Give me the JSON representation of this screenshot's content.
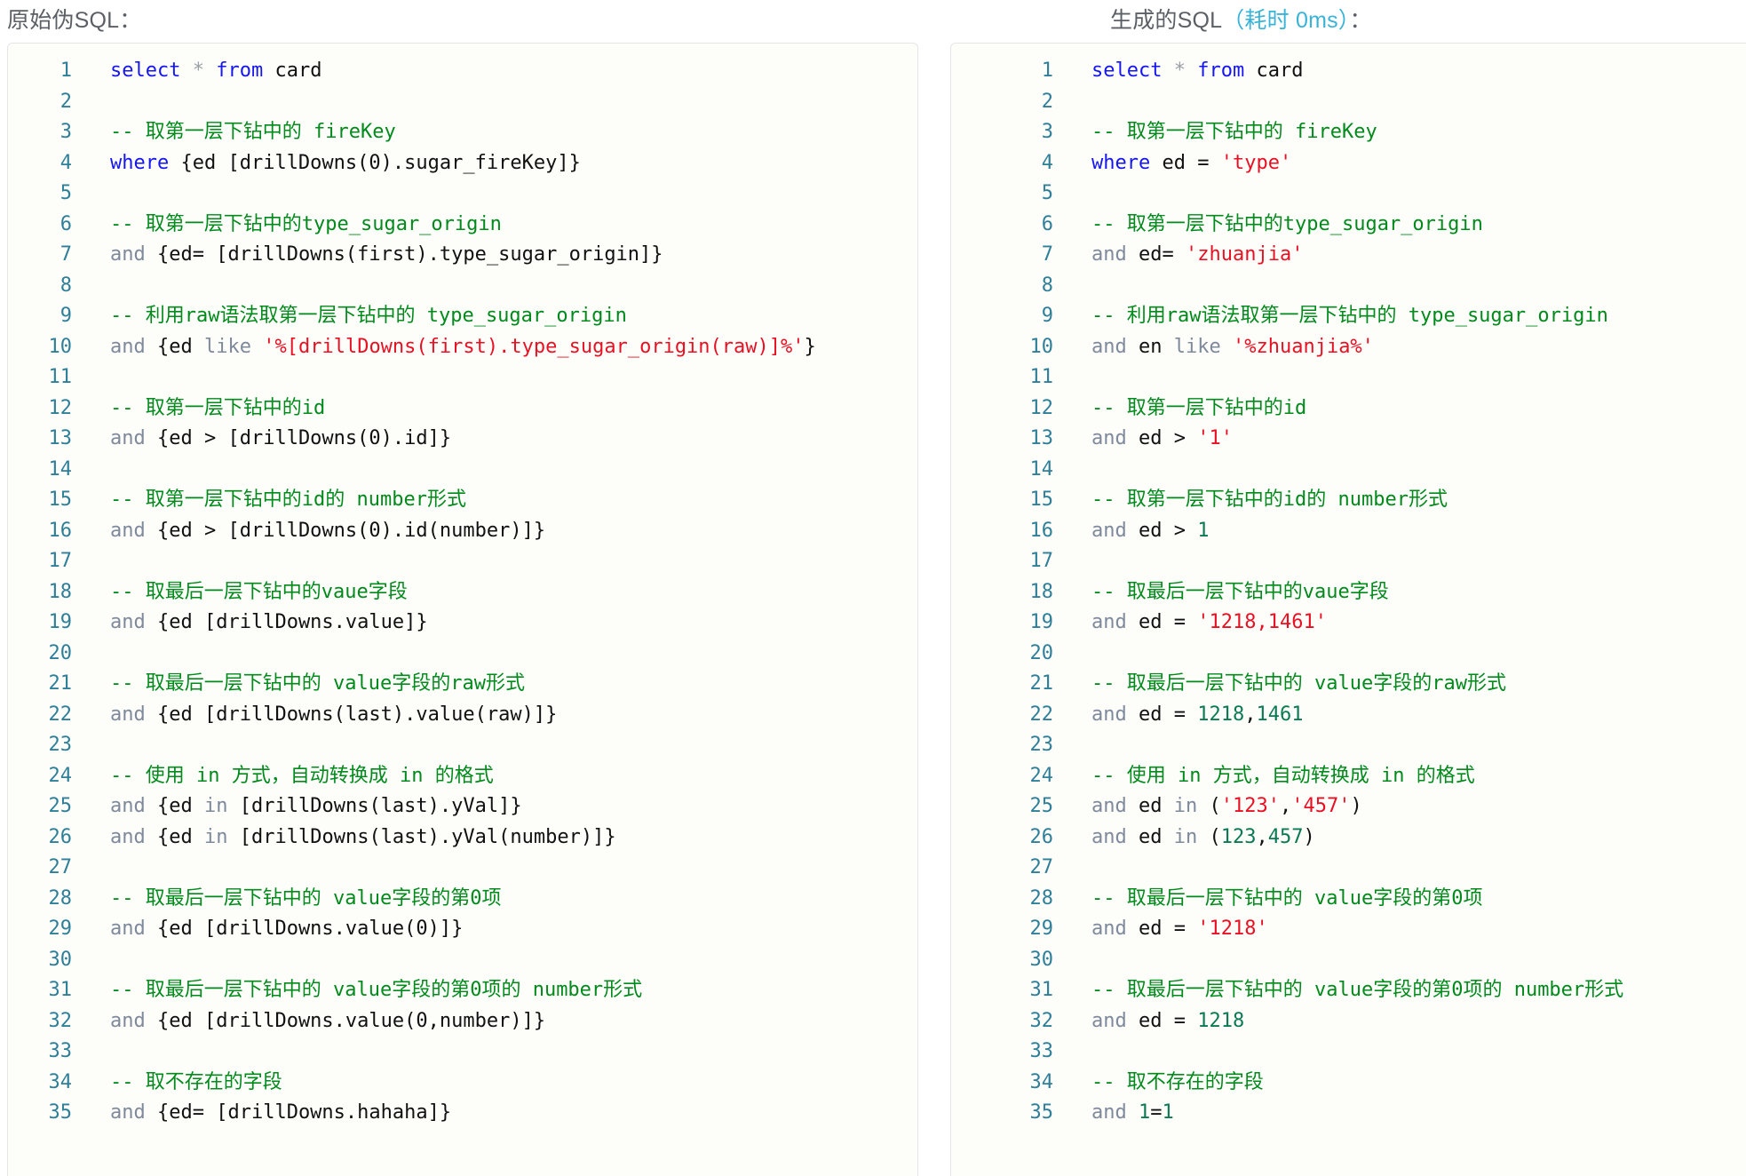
{
  "left": {
    "title": "原始伪SQL：",
    "lines": [
      {
        "n": "1",
        "tokens": [
          {
            "t": "kw",
            "v": "select"
          },
          {
            "t": "plain",
            "v": " "
          },
          {
            "t": "star",
            "v": "*"
          },
          {
            "t": "plain",
            "v": " "
          },
          {
            "t": "kw",
            "v": "from"
          },
          {
            "t": "plain",
            "v": " "
          },
          {
            "t": "id",
            "v": "card"
          }
        ]
      },
      {
        "n": "2",
        "tokens": []
      },
      {
        "n": "3",
        "tokens": [
          {
            "t": "cmt",
            "v": "-- 取第一层下钻中的 fireKey"
          }
        ]
      },
      {
        "n": "4",
        "tokens": [
          {
            "t": "kw",
            "v": "where"
          },
          {
            "t": "plain",
            "v": " "
          },
          {
            "t": "op",
            "v": "{ed [drillDowns(0).sugar_fireKey]}"
          }
        ]
      },
      {
        "n": "5",
        "tokens": []
      },
      {
        "n": "6",
        "tokens": [
          {
            "t": "cmt",
            "v": "-- 取第一层下钻中的type_sugar_origin"
          }
        ]
      },
      {
        "n": "7",
        "tokens": [
          {
            "t": "kw2",
            "v": "and"
          },
          {
            "t": "plain",
            "v": " "
          },
          {
            "t": "op",
            "v": "{ed= [drillDowns(first).type_sugar_origin]}"
          }
        ]
      },
      {
        "n": "8",
        "tokens": []
      },
      {
        "n": "9",
        "tokens": [
          {
            "t": "cmt",
            "v": "-- 利用raw语法取第一层下钻中的 type_sugar_origin"
          }
        ]
      },
      {
        "n": "10",
        "tokens": [
          {
            "t": "kw2",
            "v": "and"
          },
          {
            "t": "plain",
            "v": " "
          },
          {
            "t": "op",
            "v": "{ed"
          },
          {
            "t": "plain",
            "v": " "
          },
          {
            "t": "kw2",
            "v": "like"
          },
          {
            "t": "plain",
            "v": " "
          },
          {
            "t": "str",
            "v": "'%[drillDowns(first).type_sugar_origin(raw)]%'"
          },
          {
            "t": "op",
            "v": "}"
          }
        ]
      },
      {
        "n": "11",
        "tokens": []
      },
      {
        "n": "12",
        "tokens": [
          {
            "t": "cmt",
            "v": "-- 取第一层下钻中的id"
          }
        ]
      },
      {
        "n": "13",
        "tokens": [
          {
            "t": "kw2",
            "v": "and"
          },
          {
            "t": "plain",
            "v": " "
          },
          {
            "t": "op",
            "v": "{ed > [drillDowns(0).id]}"
          }
        ]
      },
      {
        "n": "14",
        "tokens": []
      },
      {
        "n": "15",
        "tokens": [
          {
            "t": "cmt",
            "v": "-- 取第一层下钻中的id的 number形式"
          }
        ]
      },
      {
        "n": "16",
        "tokens": [
          {
            "t": "kw2",
            "v": "and"
          },
          {
            "t": "plain",
            "v": " "
          },
          {
            "t": "op",
            "v": "{ed > [drillDowns(0).id(number)]}"
          }
        ]
      },
      {
        "n": "17",
        "tokens": []
      },
      {
        "n": "18",
        "tokens": [
          {
            "t": "cmt",
            "v": "-- 取最后一层下钻中的vaue字段"
          }
        ]
      },
      {
        "n": "19",
        "tokens": [
          {
            "t": "kw2",
            "v": "and"
          },
          {
            "t": "plain",
            "v": " "
          },
          {
            "t": "op",
            "v": "{ed [drillDowns.value]}"
          }
        ]
      },
      {
        "n": "20",
        "tokens": []
      },
      {
        "n": "21",
        "tokens": [
          {
            "t": "cmt",
            "v": "-- 取最后一层下钻中的 value字段的raw形式"
          }
        ]
      },
      {
        "n": "22",
        "tokens": [
          {
            "t": "kw2",
            "v": "and"
          },
          {
            "t": "plain",
            "v": " "
          },
          {
            "t": "op",
            "v": "{ed [drillDowns(last).value(raw)]}"
          }
        ]
      },
      {
        "n": "23",
        "tokens": []
      },
      {
        "n": "24",
        "tokens": [
          {
            "t": "cmt",
            "v": "-- 使用 in 方式，自动转换成 in 的格式"
          }
        ]
      },
      {
        "n": "25",
        "tokens": [
          {
            "t": "kw2",
            "v": "and"
          },
          {
            "t": "plain",
            "v": " "
          },
          {
            "t": "op",
            "v": "{ed"
          },
          {
            "t": "plain",
            "v": " "
          },
          {
            "t": "kw2",
            "v": "in"
          },
          {
            "t": "plain",
            "v": " "
          },
          {
            "t": "op",
            "v": "[drillDowns(last).yVal]}"
          }
        ]
      },
      {
        "n": "26",
        "tokens": [
          {
            "t": "kw2",
            "v": "and"
          },
          {
            "t": "plain",
            "v": " "
          },
          {
            "t": "op",
            "v": "{ed"
          },
          {
            "t": "plain",
            "v": " "
          },
          {
            "t": "kw2",
            "v": "in"
          },
          {
            "t": "plain",
            "v": " "
          },
          {
            "t": "op",
            "v": "[drillDowns(last).yVal(number)]}"
          }
        ]
      },
      {
        "n": "27",
        "tokens": []
      },
      {
        "n": "28",
        "tokens": [
          {
            "t": "cmt",
            "v": "-- 取最后一层下钻中的 value字段的第0项"
          }
        ]
      },
      {
        "n": "29",
        "tokens": [
          {
            "t": "kw2",
            "v": "and"
          },
          {
            "t": "plain",
            "v": " "
          },
          {
            "t": "op",
            "v": "{ed [drillDowns.value(0)]}"
          }
        ]
      },
      {
        "n": "30",
        "tokens": []
      },
      {
        "n": "31",
        "tokens": [
          {
            "t": "cmt",
            "v": "-- 取最后一层下钻中的 value字段的第0项的 number形式"
          }
        ]
      },
      {
        "n": "32",
        "tokens": [
          {
            "t": "kw2",
            "v": "and"
          },
          {
            "t": "plain",
            "v": " "
          },
          {
            "t": "op",
            "v": "{ed [drillDowns.value(0,number)]}"
          }
        ]
      },
      {
        "n": "33",
        "tokens": []
      },
      {
        "n": "34",
        "tokens": [
          {
            "t": "cmt",
            "v": "-- 取不存在的字段"
          }
        ]
      },
      {
        "n": "35",
        "tokens": [
          {
            "t": "kw2",
            "v": "and"
          },
          {
            "t": "plain",
            "v": " "
          },
          {
            "t": "op",
            "v": "{ed= [drillDowns.hahaha]}"
          }
        ]
      }
    ]
  },
  "right": {
    "title_main": "生成的SQL",
    "title_accent": "（耗时 0ms）",
    "title_tail": "：",
    "lines": [
      {
        "n": "1",
        "tokens": [
          {
            "t": "kw",
            "v": "select"
          },
          {
            "t": "plain",
            "v": " "
          },
          {
            "t": "star",
            "v": "*"
          },
          {
            "t": "plain",
            "v": " "
          },
          {
            "t": "kw",
            "v": "from"
          },
          {
            "t": "plain",
            "v": " "
          },
          {
            "t": "id",
            "v": "card"
          }
        ]
      },
      {
        "n": "2",
        "tokens": []
      },
      {
        "n": "3",
        "tokens": [
          {
            "t": "cmt",
            "v": "-- 取第一层下钻中的 fireKey"
          }
        ]
      },
      {
        "n": "4",
        "tokens": [
          {
            "t": "kw",
            "v": "where"
          },
          {
            "t": "plain",
            "v": " "
          },
          {
            "t": "id",
            "v": "ed"
          },
          {
            "t": "plain",
            "v": " "
          },
          {
            "t": "op",
            "v": "="
          },
          {
            "t": "plain",
            "v": " "
          },
          {
            "t": "str",
            "v": "'type'"
          }
        ]
      },
      {
        "n": "5",
        "tokens": []
      },
      {
        "n": "6",
        "tokens": [
          {
            "t": "cmt",
            "v": "-- 取第一层下钻中的type_sugar_origin"
          }
        ]
      },
      {
        "n": "7",
        "tokens": [
          {
            "t": "kw2",
            "v": "and"
          },
          {
            "t": "plain",
            "v": " "
          },
          {
            "t": "id",
            "v": "ed="
          },
          {
            "t": "plain",
            "v": " "
          },
          {
            "t": "str",
            "v": "'zhuanjia'"
          }
        ]
      },
      {
        "n": "8",
        "tokens": []
      },
      {
        "n": "9",
        "tokens": [
          {
            "t": "cmt",
            "v": "-- 利用raw语法取第一层下钻中的 type_sugar_origin"
          }
        ]
      },
      {
        "n": "10",
        "tokens": [
          {
            "t": "kw2",
            "v": "and"
          },
          {
            "t": "plain",
            "v": " "
          },
          {
            "t": "id",
            "v": "en"
          },
          {
            "t": "plain",
            "v": " "
          },
          {
            "t": "kw2",
            "v": "like"
          },
          {
            "t": "plain",
            "v": " "
          },
          {
            "t": "str",
            "v": "'%zhuanjia%'"
          }
        ]
      },
      {
        "n": "11",
        "tokens": []
      },
      {
        "n": "12",
        "tokens": [
          {
            "t": "cmt",
            "v": "-- 取第一层下钻中的id"
          }
        ]
      },
      {
        "n": "13",
        "tokens": [
          {
            "t": "kw2",
            "v": "and"
          },
          {
            "t": "plain",
            "v": " "
          },
          {
            "t": "id",
            "v": "ed"
          },
          {
            "t": "plain",
            "v": " "
          },
          {
            "t": "op",
            "v": ">"
          },
          {
            "t": "plain",
            "v": " "
          },
          {
            "t": "str",
            "v": "'1'"
          }
        ]
      },
      {
        "n": "14",
        "tokens": []
      },
      {
        "n": "15",
        "tokens": [
          {
            "t": "cmt",
            "v": "-- 取第一层下钻中的id的 number形式"
          }
        ]
      },
      {
        "n": "16",
        "tokens": [
          {
            "t": "kw2",
            "v": "and"
          },
          {
            "t": "plain",
            "v": " "
          },
          {
            "t": "id",
            "v": "ed"
          },
          {
            "t": "plain",
            "v": " "
          },
          {
            "t": "op",
            "v": ">"
          },
          {
            "t": "plain",
            "v": " "
          },
          {
            "t": "num",
            "v": "1"
          }
        ]
      },
      {
        "n": "17",
        "tokens": []
      },
      {
        "n": "18",
        "tokens": [
          {
            "t": "cmt",
            "v": "-- 取最后一层下钻中的vaue字段"
          }
        ]
      },
      {
        "n": "19",
        "tokens": [
          {
            "t": "kw2",
            "v": "and"
          },
          {
            "t": "plain",
            "v": " "
          },
          {
            "t": "id",
            "v": "ed"
          },
          {
            "t": "plain",
            "v": " "
          },
          {
            "t": "op",
            "v": "="
          },
          {
            "t": "plain",
            "v": " "
          },
          {
            "t": "str",
            "v": "'1218,1461'"
          }
        ]
      },
      {
        "n": "20",
        "tokens": []
      },
      {
        "n": "21",
        "tokens": [
          {
            "t": "cmt",
            "v": "-- 取最后一层下钻中的 value字段的raw形式"
          }
        ]
      },
      {
        "n": "22",
        "tokens": [
          {
            "t": "kw2",
            "v": "and"
          },
          {
            "t": "plain",
            "v": " "
          },
          {
            "t": "id",
            "v": "ed"
          },
          {
            "t": "plain",
            "v": " "
          },
          {
            "t": "op",
            "v": "="
          },
          {
            "t": "plain",
            "v": " "
          },
          {
            "t": "num",
            "v": "1218"
          },
          {
            "t": "op",
            "v": ","
          },
          {
            "t": "num",
            "v": "1461"
          }
        ]
      },
      {
        "n": "23",
        "tokens": []
      },
      {
        "n": "24",
        "tokens": [
          {
            "t": "cmt",
            "v": "-- 使用 in 方式，自动转换成 in 的格式"
          }
        ]
      },
      {
        "n": "25",
        "tokens": [
          {
            "t": "kw2",
            "v": "and"
          },
          {
            "t": "plain",
            "v": " "
          },
          {
            "t": "id",
            "v": "ed"
          },
          {
            "t": "plain",
            "v": " "
          },
          {
            "t": "kw2",
            "v": "in"
          },
          {
            "t": "plain",
            "v": " "
          },
          {
            "t": "op",
            "v": "("
          },
          {
            "t": "str",
            "v": "'123'"
          },
          {
            "t": "op",
            "v": ","
          },
          {
            "t": "str",
            "v": "'457'"
          },
          {
            "t": "op",
            "v": ")"
          }
        ]
      },
      {
        "n": "26",
        "tokens": [
          {
            "t": "kw2",
            "v": "and"
          },
          {
            "t": "plain",
            "v": " "
          },
          {
            "t": "id",
            "v": "ed"
          },
          {
            "t": "plain",
            "v": " "
          },
          {
            "t": "kw2",
            "v": "in"
          },
          {
            "t": "plain",
            "v": " "
          },
          {
            "t": "op",
            "v": "("
          },
          {
            "t": "num",
            "v": "123"
          },
          {
            "t": "op",
            "v": ","
          },
          {
            "t": "num",
            "v": "457"
          },
          {
            "t": "op",
            "v": ")"
          }
        ]
      },
      {
        "n": "27",
        "tokens": []
      },
      {
        "n": "28",
        "tokens": [
          {
            "t": "cmt",
            "v": "-- 取最后一层下钻中的 value字段的第0项"
          }
        ]
      },
      {
        "n": "29",
        "tokens": [
          {
            "t": "kw2",
            "v": "and"
          },
          {
            "t": "plain",
            "v": " "
          },
          {
            "t": "id",
            "v": "ed"
          },
          {
            "t": "plain",
            "v": " "
          },
          {
            "t": "op",
            "v": "="
          },
          {
            "t": "plain",
            "v": " "
          },
          {
            "t": "str",
            "v": "'1218'"
          }
        ]
      },
      {
        "n": "30",
        "tokens": []
      },
      {
        "n": "31",
        "tokens": [
          {
            "t": "cmt",
            "v": "-- 取最后一层下钻中的 value字段的第0项的 number形式"
          }
        ]
      },
      {
        "n": "32",
        "tokens": [
          {
            "t": "kw2",
            "v": "and"
          },
          {
            "t": "plain",
            "v": " "
          },
          {
            "t": "id",
            "v": "ed"
          },
          {
            "t": "plain",
            "v": " "
          },
          {
            "t": "op",
            "v": "="
          },
          {
            "t": "plain",
            "v": " "
          },
          {
            "t": "num",
            "v": "1218"
          }
        ]
      },
      {
        "n": "33",
        "tokens": []
      },
      {
        "n": "34",
        "tokens": [
          {
            "t": "cmt",
            "v": "-- 取不存在的字段"
          }
        ]
      },
      {
        "n": "35",
        "tokens": [
          {
            "t": "kw2",
            "v": "and"
          },
          {
            "t": "plain",
            "v": " "
          },
          {
            "t": "num",
            "v": "1"
          },
          {
            "t": "op",
            "v": "="
          },
          {
            "t": "num",
            "v": "1"
          }
        ]
      }
    ]
  },
  "colors": {
    "keyword": "#1616f0",
    "keyword_muted": "#7e8a9c",
    "comment": "#008a1c",
    "string": "#e81123",
    "number": "#0b7a54",
    "identifier": "#111111",
    "line_number": "#2f7f99",
    "title": "#5c6066",
    "title_accent": "#39b3d7",
    "code_background": "#fdfdfa",
    "code_border": "#e6e6e6"
  }
}
